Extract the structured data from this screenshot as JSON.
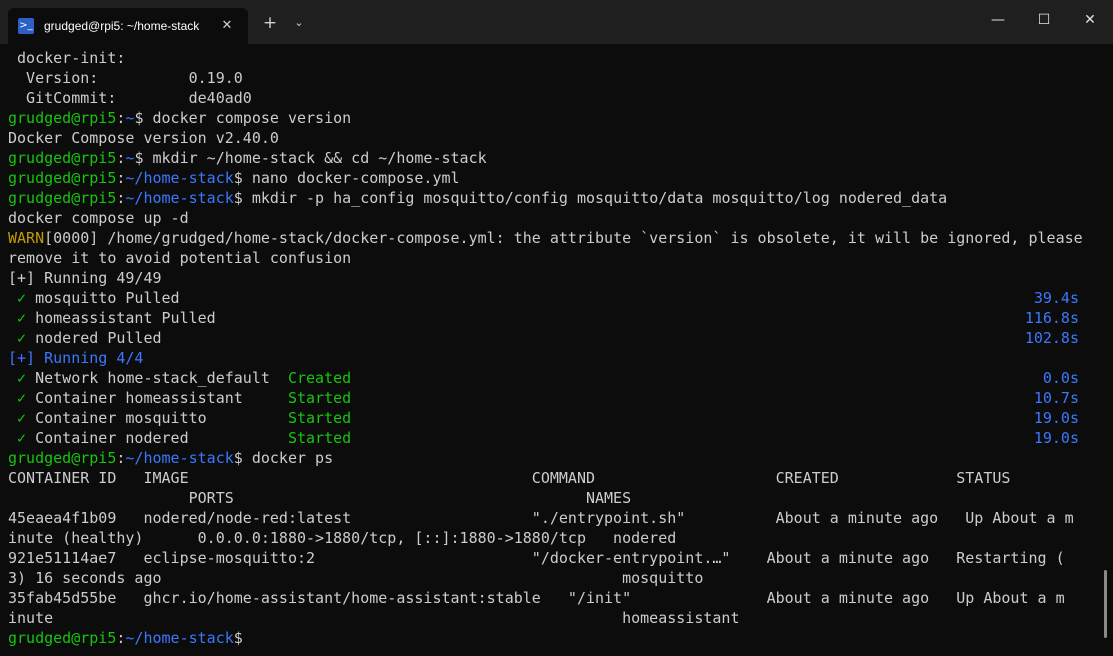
{
  "window": {
    "tab_title": "grudged@rpi5: ~/home-stack",
    "tab_icon": "terminal-icon",
    "new_tab_label": "+",
    "dropdown_label": "⌄",
    "minimize_label": "—",
    "maximize_label": "☐",
    "close_label": "✕",
    "tab_close_label": "✕"
  },
  "prompt": {
    "user": "grudged@rpi5",
    "colon": ":",
    "home": "~",
    "stack": "~/home-stack",
    "dollar": "$ "
  },
  "terminal": {
    "l0": " docker-init:",
    "l1": "  Version:          0.19.0",
    "l2": "  GitCommit:        de40ad0",
    "cmd_compose_version": "docker compose version",
    "l4": "Docker Compose version v2.40.0",
    "cmd_mkdir": "mkdir ~/home-stack && cd ~/home-stack",
    "cmd_nano": "nano docker-compose.yml",
    "cmd_mkdir_p": "mkdir -p ha_config mosquitto/config mosquitto/data mosquitto/log nodered_data",
    "l8": "docker compose up -d",
    "warn_tag": "WARN",
    "warn_text": "[0000] /home/grudged/home-stack/docker-compose.yml: the attribute `version` is obsolete, it will be ignored, please",
    "l10": "remove it to avoid potential confusion",
    "l11": "[+] Running 49/49",
    "pull": [
      {
        "check": " ✓",
        "text": " mosquitto Pulled",
        "time": "39.4s"
      },
      {
        "check": " ✓",
        "text": " homeassistant Pulled",
        "time": "116.8s"
      },
      {
        "check": " ✓",
        "text": " nodered Pulled",
        "time": "102.8s"
      }
    ],
    "l15": "[+] Running 4/4",
    "start": [
      {
        "check": " ✓",
        "text": " Network home-stack_default  ",
        "state": "Created",
        "time": "0.0s"
      },
      {
        "check": " ✓",
        "text": " Container homeassistant     ",
        "state": "Started",
        "time": "10.7s"
      },
      {
        "check": " ✓",
        "text": " Container mosquitto         ",
        "state": "Started",
        "time": "19.0s"
      },
      {
        "check": " ✓",
        "text": " Container nodered           ",
        "state": "Started",
        "time": "19.0s"
      }
    ],
    "cmd_ps": "docker ps",
    "ps": {
      "header1": "CONTAINER ID   IMAGE                                      COMMAND                    CREATED             STATUS",
      "header2": "                    PORTS                                       NAMES",
      "r1a": "45eaea4f1b09   nodered/node-red:latest                    \"./entrypoint.sh\"          About a minute ago   Up About a m",
      "r1b": "inute (healthy)      0.0.0.0:1880->1880/tcp, [::]:1880->1880/tcp   nodered",
      "r2a": "921e51114ae7   eclipse-mosquitto:2                        \"/docker-entrypoint.…\"    About a minute ago   Restarting (",
      "r2b": "3) 16 seconds ago                                                   mosquitto",
      "r3a": "35fab45d55be   ghcr.io/home-assistant/home-assistant:stable   \"/init\"               About a minute ago   Up About a m",
      "r3b": "inute                                                               homeassistant"
    }
  }
}
